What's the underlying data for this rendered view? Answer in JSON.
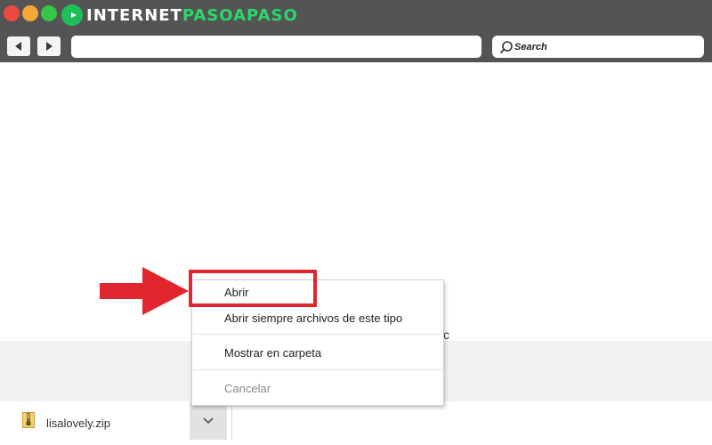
{
  "brand": {
    "name_part1": "INTERNET",
    "name_part2": "PASOAPASO",
    "accent_color": "#2bd66b"
  },
  "toolbar": {
    "back_icon": "back-arrow-icon",
    "forward_icon": "forward-arrow-icon",
    "address_value": "",
    "search_placeholder": "Search"
  },
  "context_menu": {
    "items": [
      {
        "label": "Abrir",
        "enabled": true,
        "highlighted": true
      },
      {
        "label": "Abrir siempre archivos de este tipo",
        "enabled": true
      },
      {
        "label": "Mostrar en carpeta",
        "enabled": true
      },
      {
        "label": "Cancelar",
        "enabled": false
      }
    ]
  },
  "downloads": {
    "file_name": "lisalovely.zip",
    "file_icon": "zip-file-icon"
  },
  "partial_text": "c",
  "colors": {
    "titlebar": "#545454",
    "highlight": "#e1262d",
    "arrow": "#e1262d"
  }
}
